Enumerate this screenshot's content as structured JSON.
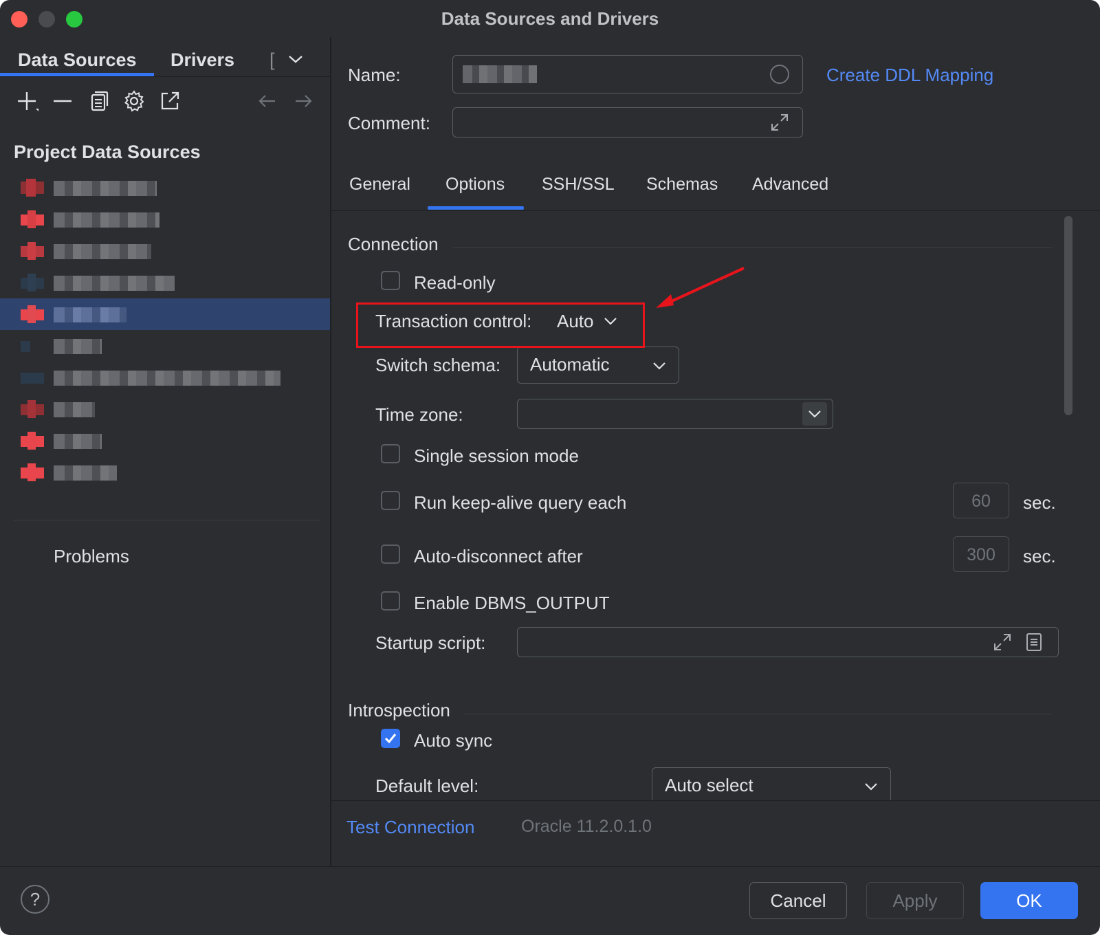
{
  "window": {
    "title": "Data Sources and Drivers"
  },
  "left": {
    "tabs": [
      "Data Sources",
      "Drivers",
      "["
    ],
    "section_title": "Project Data Sources",
    "problems_label": "Problems"
  },
  "right": {
    "name_label": "Name:",
    "comment_label": "Comment:",
    "ddl_link": "Create DDL Mapping",
    "tabs": [
      "General",
      "Options",
      "SSH/SSL",
      "Schemas",
      "Advanced"
    ],
    "active_tab": "Options",
    "connection": {
      "title": "Connection",
      "read_only": {
        "label": "Read-only",
        "checked": false
      },
      "transaction_control": {
        "label": "Transaction control:",
        "value": "Auto"
      },
      "switch_schema": {
        "label": "Switch schema:",
        "value": "Automatic"
      },
      "time_zone": {
        "label": "Time zone:",
        "value": ""
      },
      "single_session": {
        "label": "Single session mode",
        "checked": false
      },
      "keep_alive": {
        "label": "Run keep-alive query each",
        "value": "60",
        "unit": "sec.",
        "checked": false
      },
      "auto_disconnect": {
        "label": "Auto-disconnect after",
        "value": "300",
        "unit": "sec.",
        "checked": false
      },
      "dbms_output": {
        "label": "Enable DBMS_OUTPUT",
        "checked": false
      },
      "startup_script": {
        "label": "Startup script:",
        "value": ""
      }
    },
    "introspection": {
      "title": "Introspection",
      "auto_sync": {
        "label": "Auto sync",
        "checked": true
      },
      "default_level": {
        "label": "Default level:",
        "value": "Auto select"
      }
    },
    "test_connection": "Test Connection",
    "version": "Oracle 11.2.0.1.0"
  },
  "buttons": {
    "help": "?",
    "cancel": "Cancel",
    "apply": "Apply",
    "ok": "OK"
  },
  "colors": {
    "accent": "#3574f0",
    "link": "#548af7",
    "highlight": "#e8141c",
    "background": "#2b2d30"
  }
}
